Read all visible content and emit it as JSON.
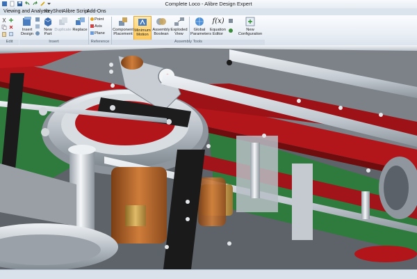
{
  "window": {
    "title": "Complete Loco - Alibre Design Expert"
  },
  "menu": [
    "Viewing and Analysis",
    "KeyShot",
    "Alibre Script",
    "Add-Ons"
  ],
  "ribbon": {
    "insert_design": [
      "Insert",
      "Design"
    ],
    "new_part": [
      "New",
      "Part"
    ],
    "duplicate": "Duplicate",
    "replace": "Replace",
    "point": "Point",
    "axis": "Axis",
    "plane": "Plane",
    "component_placement": [
      "Component",
      "Placement"
    ],
    "minimum_motion": [
      "Minimum",
      "Motion"
    ],
    "assembly_boolean": [
      "Assembly",
      "Boolean"
    ],
    "exploded_view": [
      "Exploded",
      "View"
    ],
    "global_parameters": [
      "Global",
      "Parameters"
    ],
    "equation_editor": [
      "Equation",
      "Editor"
    ],
    "new_configuration": [
      "New",
      "Configuration"
    ],
    "fx_glyph": "f(x)",
    "groups": {
      "edit": "Edit",
      "insert": "Insert",
      "reference": "Reference",
      "assembly_tools": "Assembly Tools"
    }
  },
  "colors": {
    "chassis_red": "#b3161a",
    "wheel_steel": "#c4c9ce",
    "brass": "#c89a42",
    "bronze": "#b0642a",
    "ground_green": "#2f7a3d",
    "ribbon_active": "#ffc95a"
  }
}
